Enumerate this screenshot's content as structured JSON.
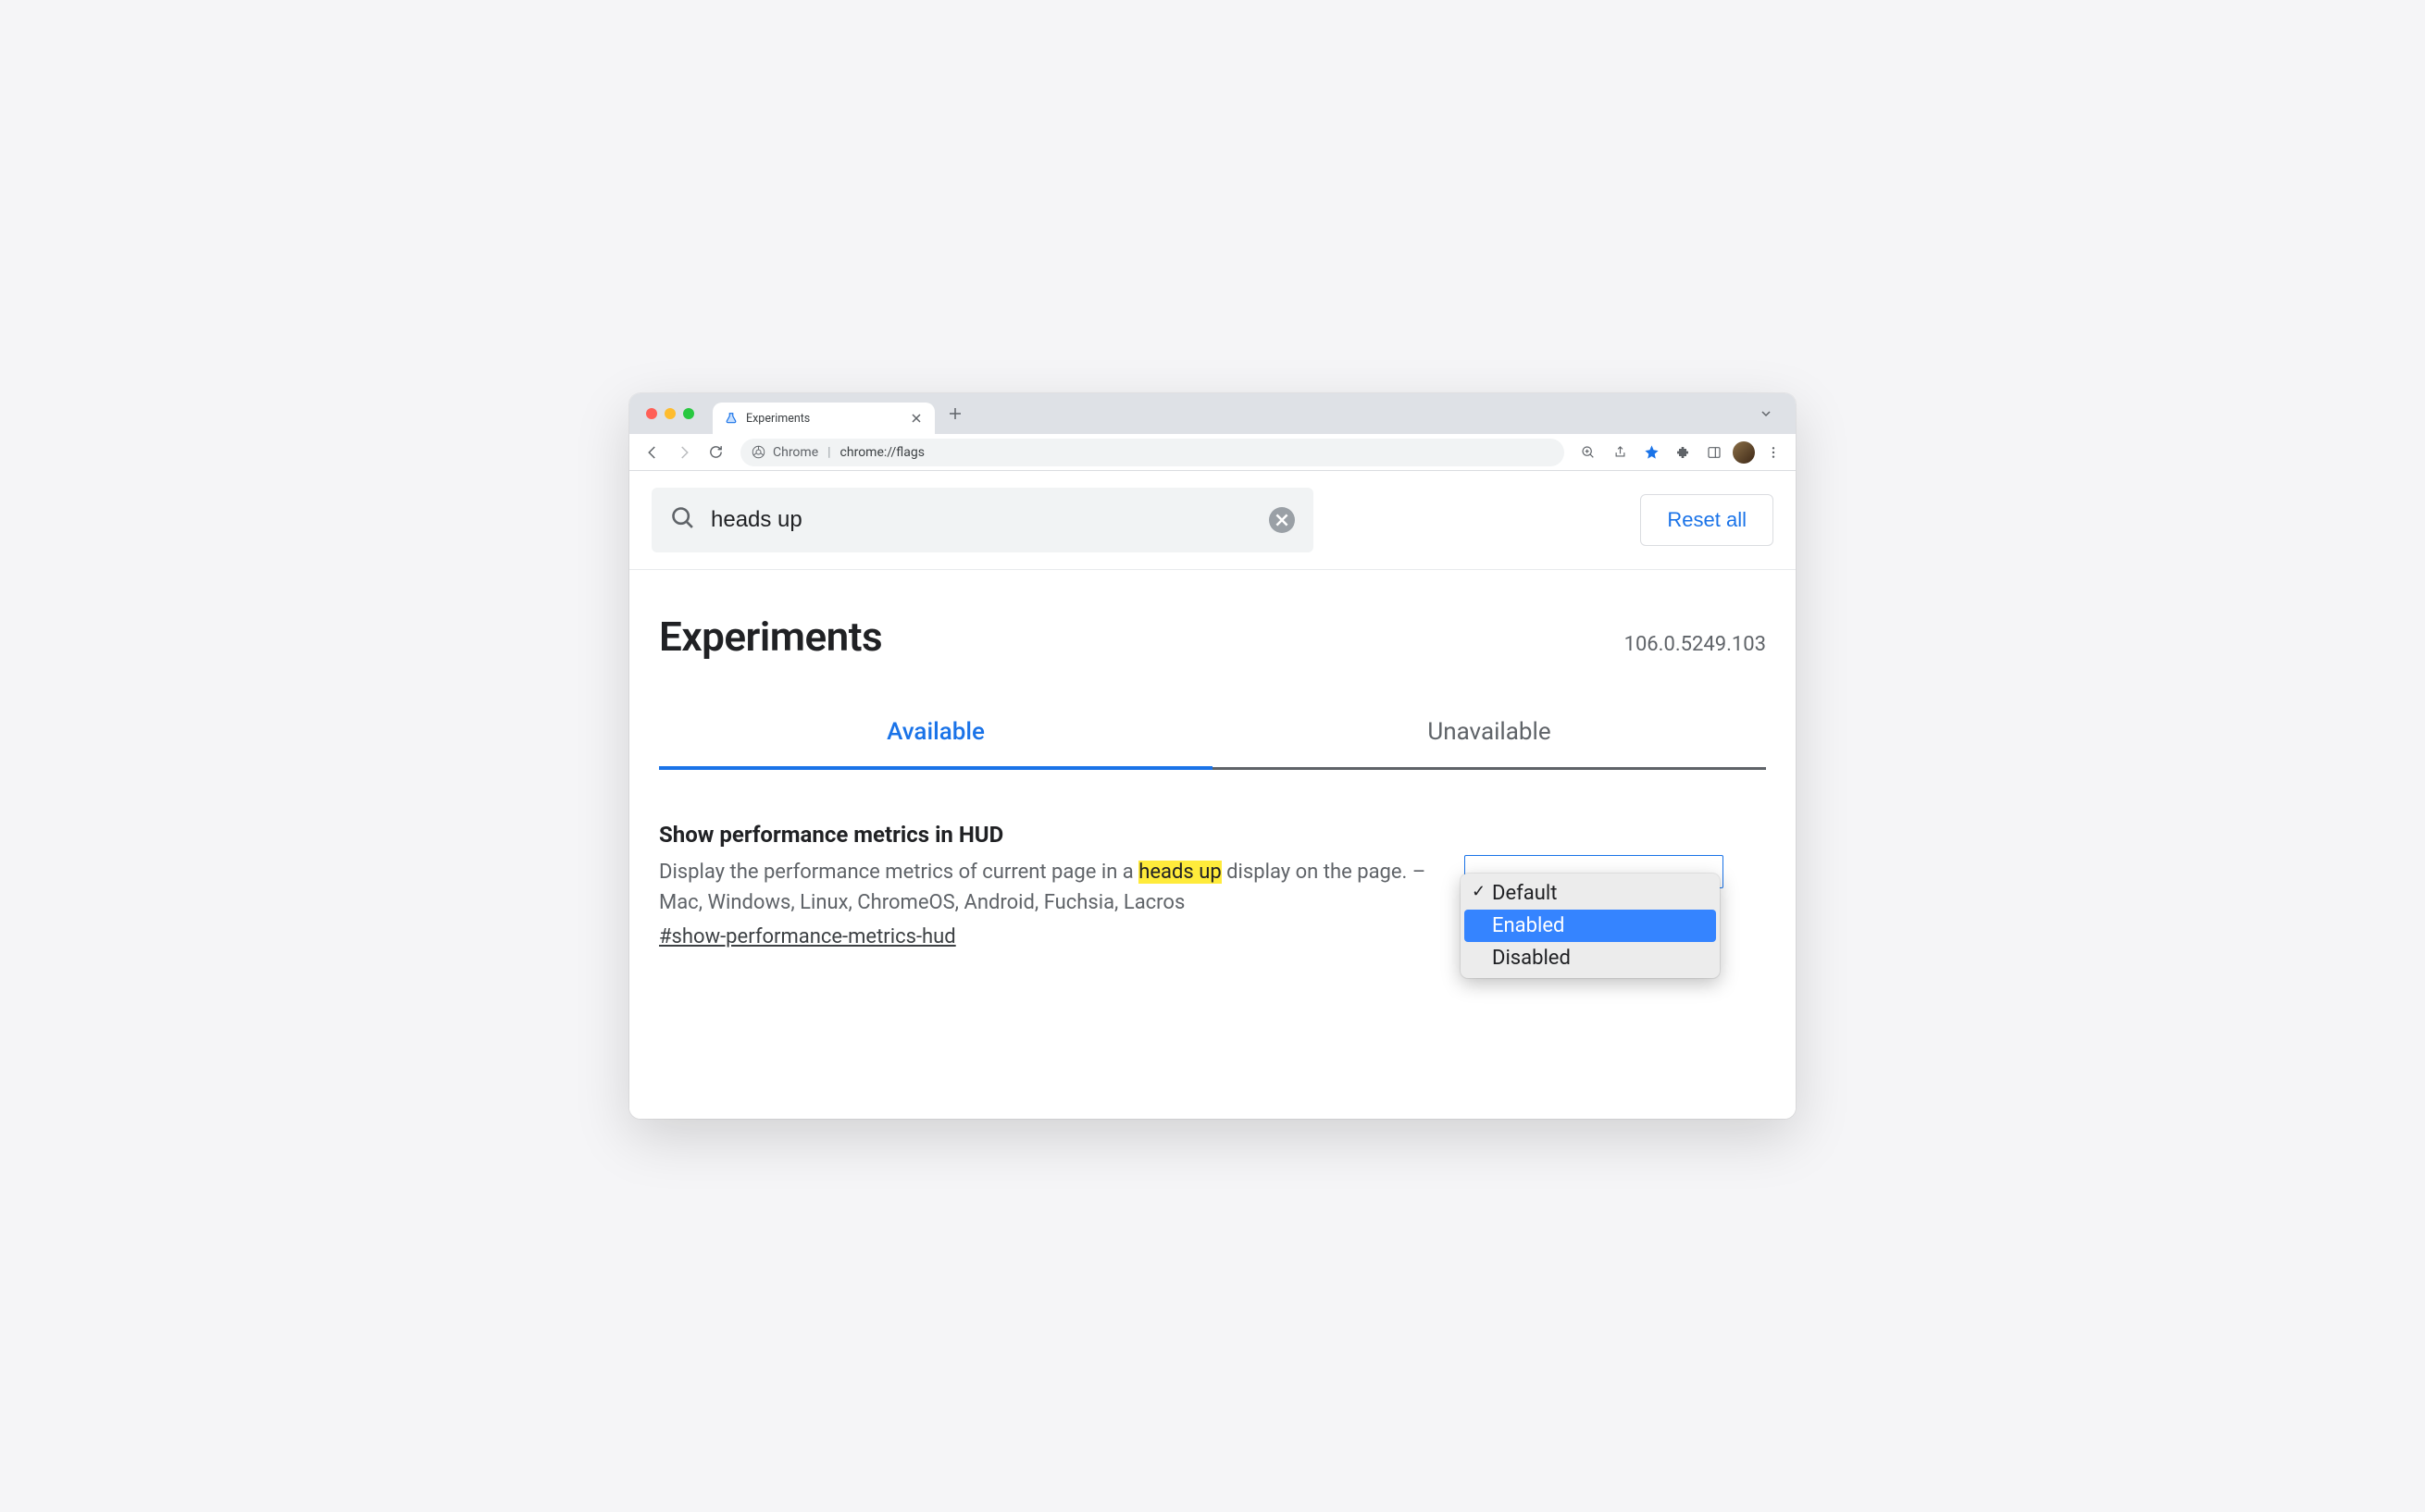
{
  "browser": {
    "tab_title": "Experiments",
    "omnibox_label": "Chrome",
    "omnibox_url": "chrome://flags"
  },
  "search": {
    "value": "heads up",
    "reset_label": "Reset all"
  },
  "header": {
    "title": "Experiments",
    "version": "106.0.5249.103"
  },
  "tabs": {
    "available": "Available",
    "unavailable": "Unavailable"
  },
  "flag": {
    "title": "Show performance metrics in HUD",
    "desc_pre": "Display the performance metrics of current page in a ",
    "desc_highlight": "heads up",
    "desc_post": " display on the page. – Mac, Windows, Linux, ChromeOS, Android, Fuchsia, Lacros",
    "anchor": "#show-performance-metrics-hud",
    "options": {
      "default": "Default",
      "enabled": "Enabled",
      "disabled": "Disabled"
    }
  }
}
